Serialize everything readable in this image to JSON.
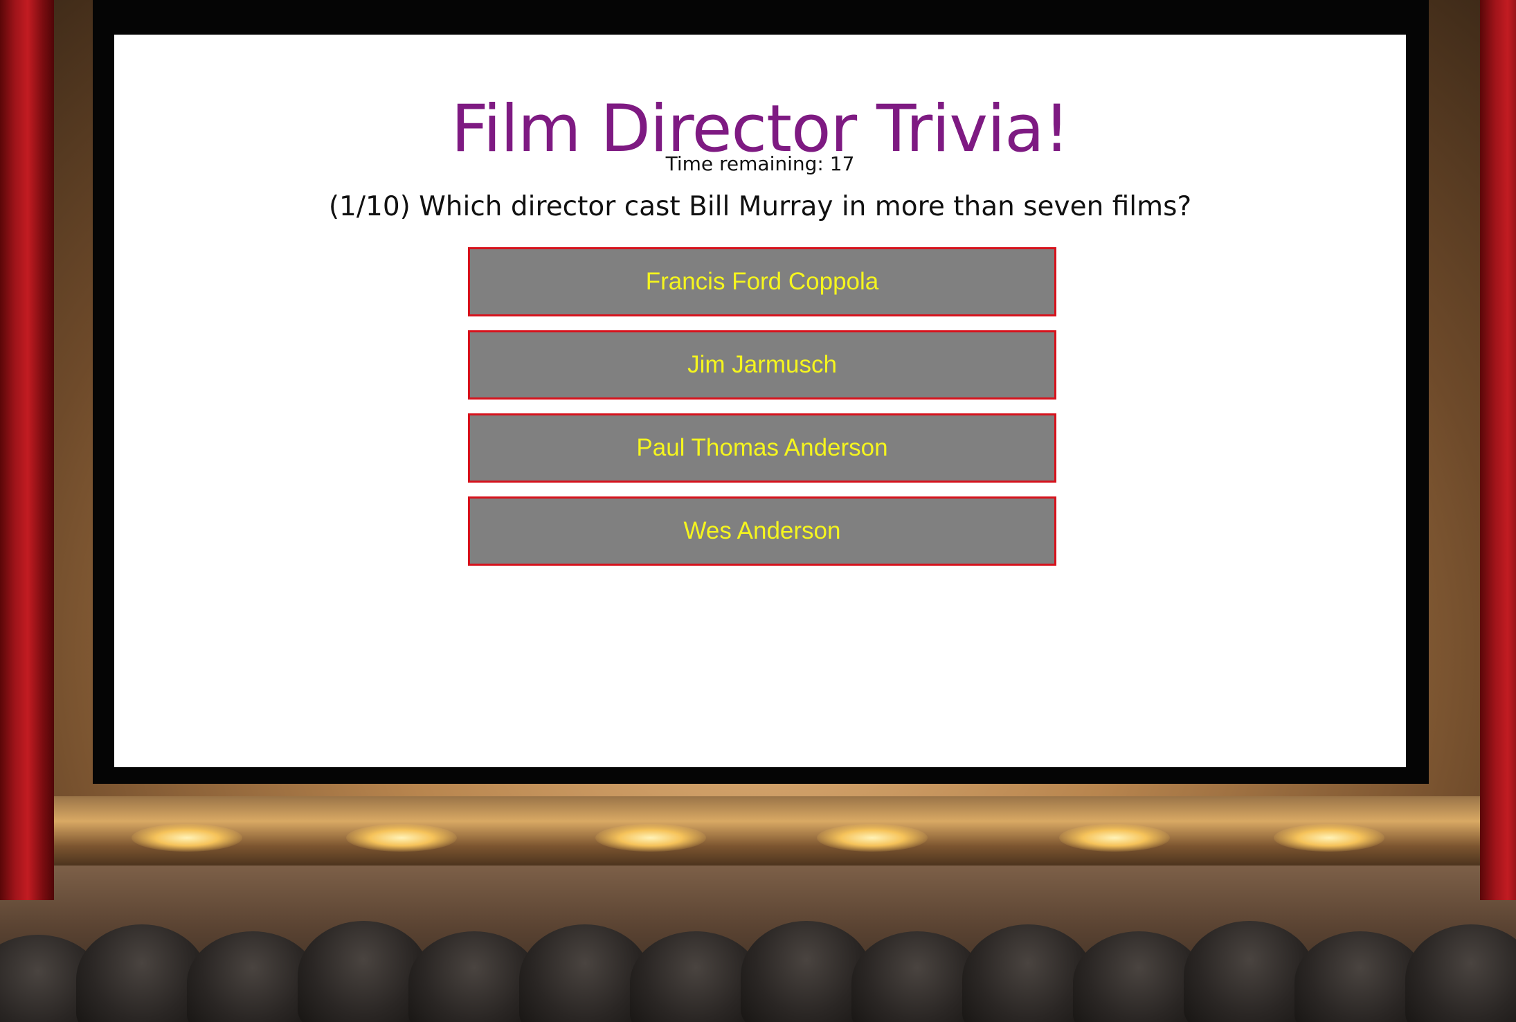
{
  "game": {
    "title": "Film Director Trivia!",
    "timer_label": "Time remaining: 17",
    "question": "(1/10) Which director cast Bill Murray in more than seven films?",
    "answers": [
      {
        "label": "Francis Ford Coppola"
      },
      {
        "label": "Jim Jarmusch"
      },
      {
        "label": "Paul Thomas Anderson"
      },
      {
        "label": "Wes Anderson"
      }
    ]
  },
  "colors": {
    "title": "#7e1a82",
    "answer_bg": "#808080",
    "answer_border": "#d6121c",
    "answer_text": "#f5f51e"
  }
}
